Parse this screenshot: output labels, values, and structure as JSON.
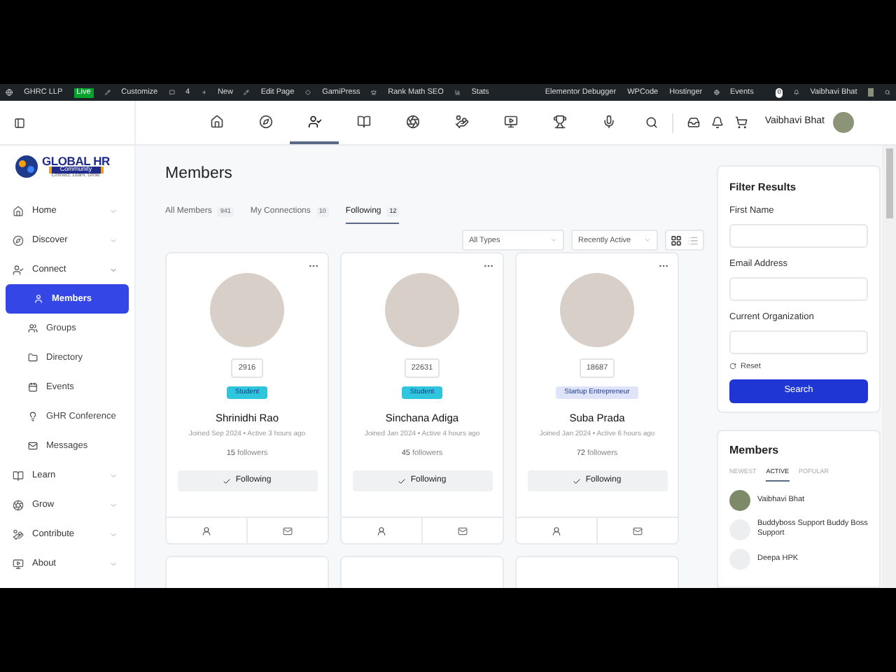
{
  "admin_bar": {
    "site": "GHRC LLP",
    "live": "Live",
    "items": [
      "Customize",
      "4",
      "New",
      "Edit Page",
      "GamiPress",
      "Rank Math SEO",
      "Stats",
      "Elementor Debugger",
      "WPCode",
      "Hostinger",
      "Events"
    ],
    "notifications": "0",
    "user": "Vaibhavi Bhat"
  },
  "header": {
    "nav": [
      {
        "selected": false
      },
      {
        "selected": false
      },
      {
        "selected": true
      },
      {
        "selected": false
      },
      {
        "selected": false
      },
      {
        "selected": false
      },
      {
        "selected": false
      },
      {
        "selected": false
      },
      {
        "selected": false
      }
    ],
    "user": "Vaibhavi Bhat"
  },
  "logo": {
    "title": "GLOBAL HR",
    "subtitle": "Community",
    "tagline": "Connect. Learn. Grow."
  },
  "sidebar": {
    "items": [
      {
        "label": "Home",
        "expanded": false
      },
      {
        "label": "Discover",
        "expanded": false
      },
      {
        "label": "Connect",
        "expanded": true,
        "children": [
          {
            "label": "Members",
            "selected": true
          },
          {
            "label": "Groups",
            "selected": false
          },
          {
            "label": "Directory",
            "selected": false
          },
          {
            "label": "Events",
            "selected": false
          },
          {
            "label": "GHR Conference",
            "selected": false
          },
          {
            "label": "Messages",
            "selected": false
          }
        ]
      },
      {
        "label": "Learn",
        "expanded": false
      },
      {
        "label": "Grow",
        "expanded": false
      },
      {
        "label": "Contribute",
        "expanded": false
      },
      {
        "label": "About",
        "expanded": false
      }
    ]
  },
  "page_title": "Members",
  "tabs": [
    {
      "label": "All Members",
      "count": "941",
      "selected": false
    },
    {
      "label": "My Connections",
      "count": "10",
      "selected": false
    },
    {
      "label": "Following",
      "count": "12",
      "selected": true
    }
  ],
  "filters": {
    "type": "All Types",
    "order": "Recently Active",
    "grid_view": true
  },
  "members": [
    {
      "count": "2916",
      "type": {
        "label": "Student",
        "color": "#2ec5dd"
      },
      "name": "Shrinidhi Rao",
      "meta": "Joined Sep 2024 • Active 3 hours ago",
      "followers": "15",
      "followers_label": "followers",
      "button": "Following"
    },
    {
      "count": "22631",
      "type": {
        "label": "Student",
        "color": "#2ec5dd"
      },
      "name": "Sinchana Adiga",
      "meta": "Joined Jan 2024 • Active 4 hours ago",
      "followers": "45",
      "followers_label": "followers",
      "button": "Following"
    },
    {
      "count": "18687",
      "type": {
        "label": "Startup Entrepreneur",
        "color": "#dfe4fb"
      },
      "name": "Suba Prada",
      "meta": "Joined Jan 2024 • Active 6 hours ago",
      "followers": "72",
      "followers_label": "followers",
      "button": "Following"
    }
  ],
  "filter_panel": {
    "title": "Filter Results",
    "fields": [
      {
        "label": "First Name"
      },
      {
        "label": "Email Address"
      },
      {
        "label": "Current Organization"
      }
    ],
    "reset": "Reset",
    "search": "Search"
  },
  "members_widget": {
    "title": "Members",
    "tabs": [
      {
        "label": "NEWEST",
        "selected": false
      },
      {
        "label": "ACTIVE",
        "selected": true
      },
      {
        "label": "POPULAR",
        "selected": false
      }
    ],
    "list": [
      {
        "name": "Vaibhavi Bhat"
      },
      {
        "name": "Buddyboss Support Buddy Boss Support"
      },
      {
        "name": "Deepa HPK"
      }
    ]
  }
}
